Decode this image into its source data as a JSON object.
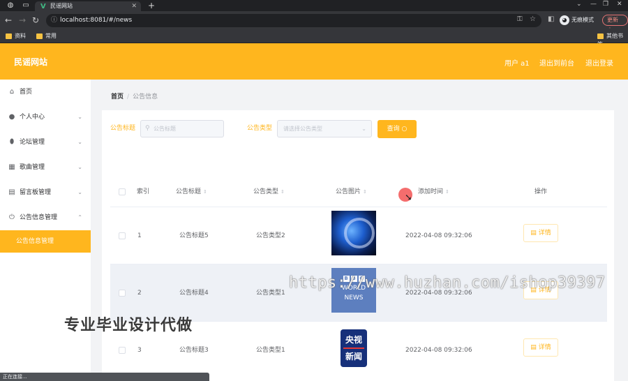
{
  "browser": {
    "tab_title": "民谣网站",
    "url": "localhost:8081/#/news",
    "profile_label": "无痕模式",
    "update_label": "更新",
    "bookmarks": [
      "资料",
      "常用"
    ],
    "other_bookmarks": "其他书签"
  },
  "header": {
    "site_title": "民谣网站",
    "user_label": "用户 a1",
    "back_label": "退出到前台",
    "logout_label": "退出登录"
  },
  "sidebar": {
    "items": [
      {
        "label": "首页",
        "icon": "home-icon"
      },
      {
        "label": "个人中心",
        "icon": "user-icon"
      },
      {
        "label": "论坛管理",
        "icon": "pin-icon"
      },
      {
        "label": "歌曲管理",
        "icon": "grid-icon"
      },
      {
        "label": "留言板管理",
        "icon": "clipboard-icon"
      },
      {
        "label": "公告信息管理",
        "icon": "power-icon"
      }
    ],
    "active_sub": "公告信息管理"
  },
  "breadcrumb": {
    "home": "首页",
    "current": "公告信息"
  },
  "search": {
    "title_label": "公告标题",
    "title_placeholder": "公告标题",
    "type_label": "公告类型",
    "type_placeholder": "请选择公告类型",
    "query_label": "查询"
  },
  "table": {
    "headers": [
      "索引",
      "公告标题",
      "公告类型",
      "公告图片",
      "添加时间",
      "操作"
    ],
    "rows": [
      {
        "index": "1",
        "title": "公告标题5",
        "type": "公告类型2",
        "time": "2022-04-08 09:32:06",
        "image": "globe-news-image"
      },
      {
        "index": "2",
        "title": "公告标题4",
        "type": "公告类型1",
        "time": "2022-04-08 09:32:06",
        "image": "bbc-world-news-image",
        "image_text": [
          "BBC",
          "WORLD",
          "NEWS"
        ]
      },
      {
        "index": "3",
        "title": "公告标题3",
        "type": "公告类型1",
        "time": "2022-04-08 09:32:06",
        "image": "cctv-news-image",
        "image_text": [
          "央视",
          "新闻"
        ]
      }
    ],
    "detail_label": "详情"
  },
  "overlay": {
    "watermark_url": "https://www.huzhan.com/ishop39397",
    "watermark_cn": "专业毕业设计代做",
    "status": "正在连接..."
  },
  "colors": {
    "accent": "#ffb61e",
    "chrome_dark": "#202124",
    "chrome_bar": "#35363a"
  }
}
